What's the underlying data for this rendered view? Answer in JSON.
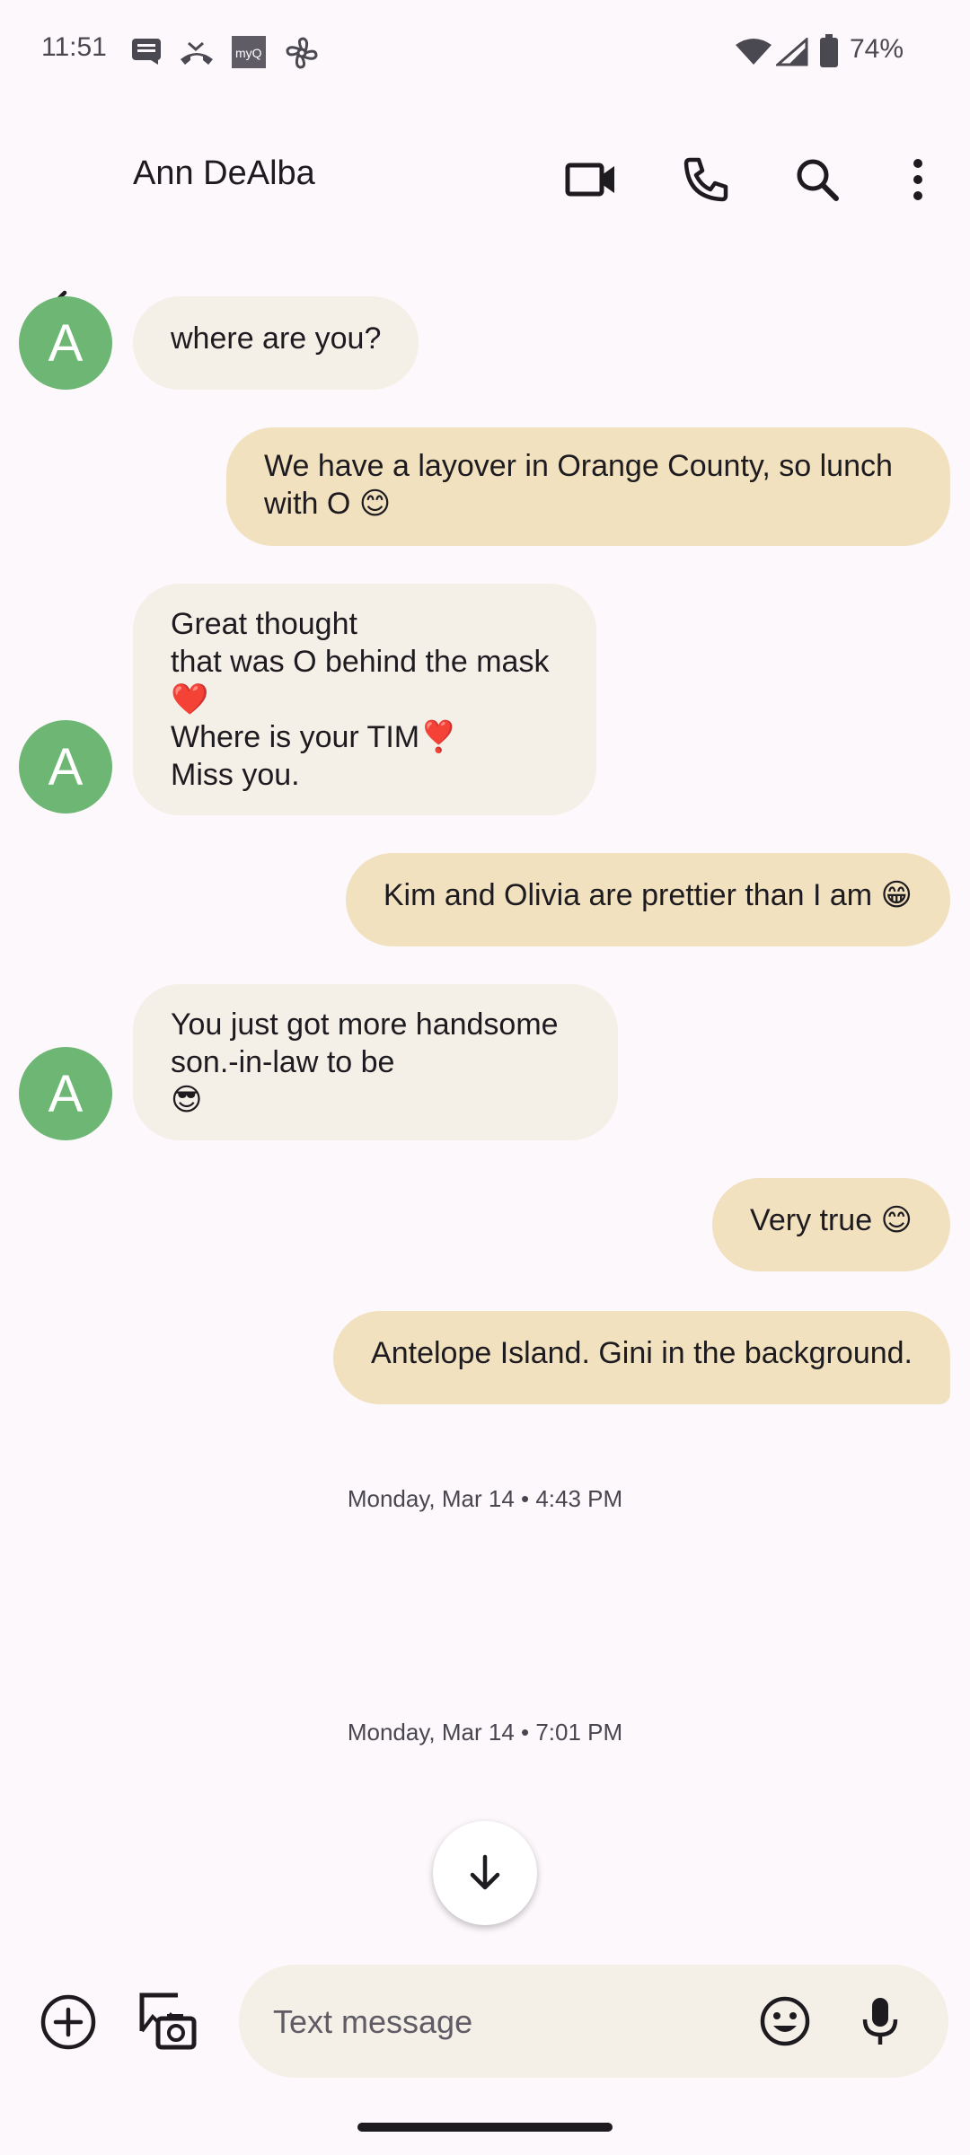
{
  "status_bar": {
    "time": "11:51",
    "battery": "74%",
    "icons": [
      "message-notification-icon",
      "missed-call-icon",
      "myq-icon",
      "pinwheel-icon",
      "wifi-icon",
      "signal-icon",
      "battery-icon"
    ],
    "myq_text": "myQ"
  },
  "app_bar": {
    "contact_name": "Ann DeAlba"
  },
  "messages": [
    {
      "dir": "in",
      "avatar_letter": "A",
      "text": "where are you?"
    },
    {
      "dir": "out",
      "text": "We have a layover in Orange County, so lunch\nwith O 😊"
    },
    {
      "dir": "in",
      "avatar_letter": "A",
      "text": "Great thought\nthat was O behind the mask\n❤️\nWhere is your TIM❣️\nMiss you."
    },
    {
      "dir": "out",
      "text": "Kim and Olivia are prettier than I am 😁"
    },
    {
      "dir": "in",
      "avatar_letter": "A",
      "text": "You just got more handsome\nson.-in-law to be\n😎"
    },
    {
      "dir": "out",
      "text": "Very true 😊"
    },
    {
      "dir": "out",
      "text": "Antelope Island. Gini in the background."
    }
  ],
  "timestamps": [
    "Monday, Mar 14 • 4:43 PM",
    "Monday, Mar 14 • 7:01 PM"
  ],
  "compose": {
    "placeholder": "Text message"
  },
  "colors": {
    "background": "#FDF8FC",
    "incoming_bubble": "#F4EFE7",
    "outgoing_bubble": "#F1E1BE",
    "avatar": "#6DB674"
  }
}
